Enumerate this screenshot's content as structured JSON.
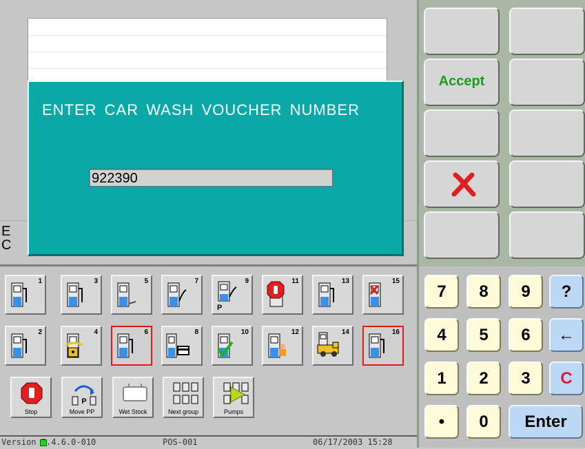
{
  "receipt_text": {
    "line1": "E",
    "line2": "C"
  },
  "dialog": {
    "prompt": "ENTER CAR WASH VOUCHER NUMBER",
    "value": "922390"
  },
  "function_keys": {
    "accept_label": "Accept",
    "cancel_icon": "red-x-icon"
  },
  "pumps": [
    {
      "n": "1"
    },
    {
      "n": "2"
    },
    {
      "n": "3"
    },
    {
      "n": "4"
    },
    {
      "n": "5"
    },
    {
      "n": "6"
    },
    {
      "n": "7"
    },
    {
      "n": "8"
    },
    {
      "n": "9",
      "mark": "P"
    },
    {
      "n": "10"
    },
    {
      "n": "11"
    },
    {
      "n": "12"
    },
    {
      "n": "13"
    },
    {
      "n": "14"
    },
    {
      "n": "15"
    },
    {
      "n": "16"
    }
  ],
  "tools": {
    "stop": "Stop",
    "move_pp": "Move PP",
    "wet_stock": "Wet Stock",
    "next_group": "Next group",
    "pumps": "Pumps"
  },
  "numpad": {
    "k7": "7",
    "k8": "8",
    "k9": "9",
    "help": "?",
    "k4": "4",
    "k5": "5",
    "k6": "6",
    "back": "←",
    "k1": "1",
    "k2": "2",
    "k3": "3",
    "clear": "C",
    "dot": "•",
    "k0": "0",
    "enter": "Enter"
  },
  "status": {
    "version": "Version 3.4.6.0-010",
    "pos": "POS-001",
    "datetime": "06/17/2003 15:28"
  },
  "colors": {
    "dialog_bg": "#0aa9a8",
    "accept_green": "#1c9b1c",
    "cancel_red": "#e02020",
    "selected_border": "#e21a1a",
    "key_yellow": "#fffbd8",
    "key_blue": "#bcd8f4"
  }
}
